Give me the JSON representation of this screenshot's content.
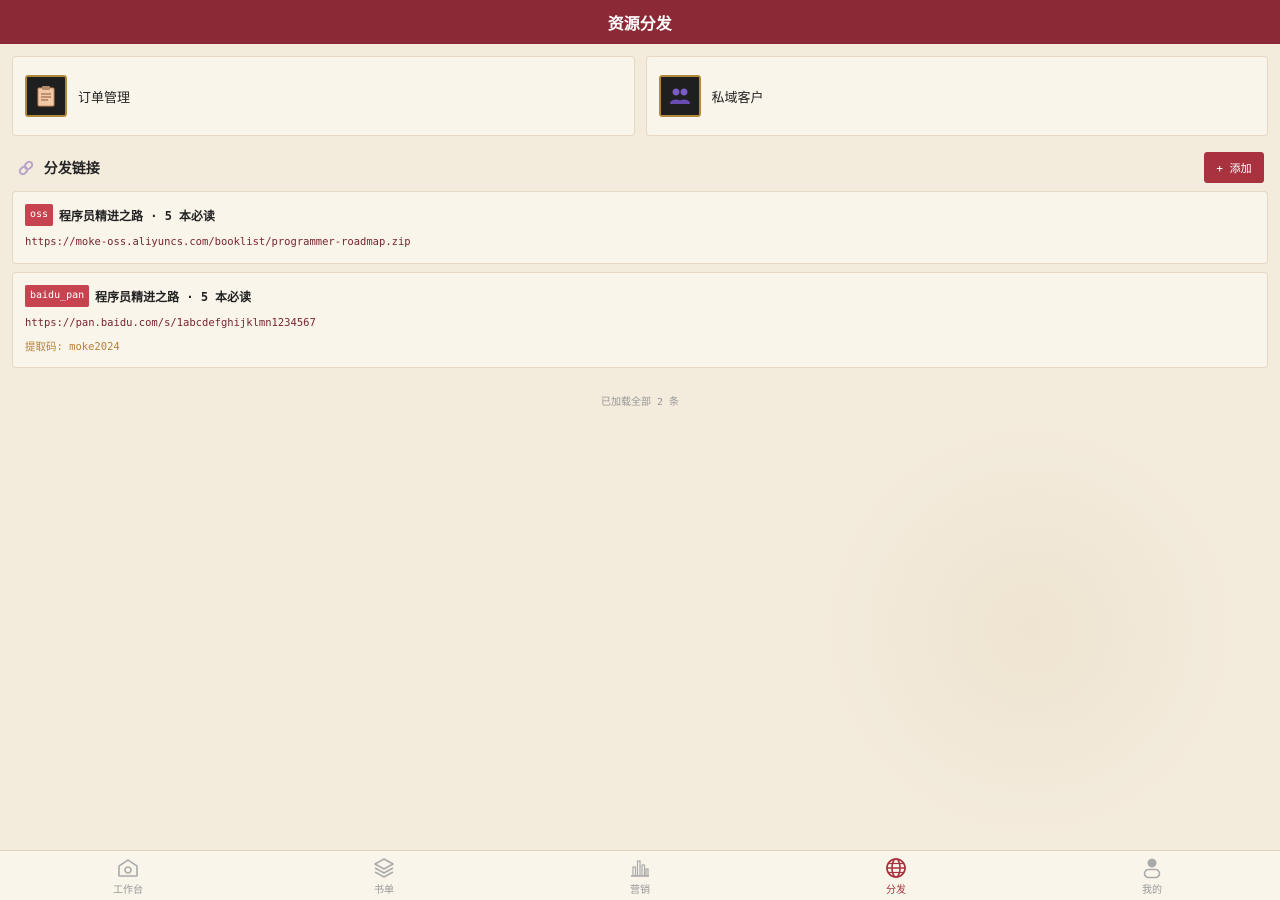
{
  "header": {
    "title": "资源分发"
  },
  "quick_actions": [
    {
      "label": "订单管理",
      "icon": "clipboard-icon"
    },
    {
      "label": "私域客户",
      "icon": "users-icon"
    }
  ],
  "section": {
    "title": "分发链接",
    "icon": "link-icon",
    "add_label": "+ 添加"
  },
  "links": [
    {
      "tag": "oss",
      "title": "程序员精进之路 · 5 本必读",
      "url": "https://moke-oss.aliyuncs.com/booklist/programmer-roadmap.zip"
    },
    {
      "tag": "baidu_pan",
      "title": "程序员精进之路 · 5 本必读",
      "url": "https://pan.baidu.com/s/1abcdefghijklmn1234567",
      "code": "提取码: moke2024"
    }
  ],
  "footer_note": "已加载全部 2 条",
  "tabs": [
    {
      "label": "工作台",
      "icon": "home-icon",
      "active": false
    },
    {
      "label": "书单",
      "icon": "layers-icon",
      "active": false
    },
    {
      "label": "营销",
      "icon": "bar-chart-icon",
      "active": false
    },
    {
      "label": "分发",
      "icon": "globe-icon",
      "active": true
    },
    {
      "label": "我的",
      "icon": "user-icon",
      "active": false
    }
  ],
  "colors": {
    "brand": "#8b2a36",
    "accent": "#a8333f",
    "tag": "#c5444f",
    "background": "#f3ebdc",
    "card": "#faf5ea"
  }
}
